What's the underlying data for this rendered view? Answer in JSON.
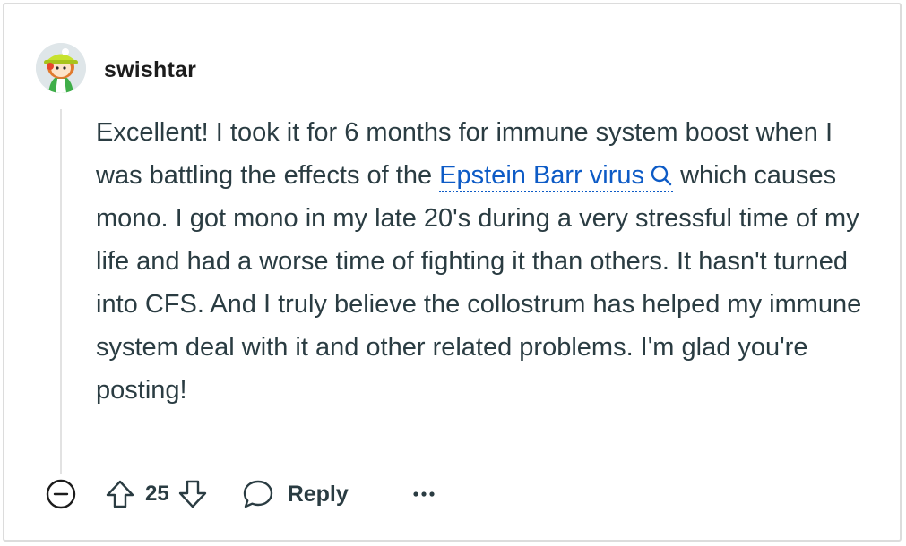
{
  "comment": {
    "author": "swishtar",
    "body_start": "Excellent! I took it for 6 months for immune system boost when I was battling the effects of the ",
    "link_text": "Epstein Barr virus",
    "body_end": " which causes mono. I got mono in my late 20's during a very stressful time of my life and had a worse time of fighting it than others. It hasn't turned into CFS. And I truly believe the collostrum has helped my immune system deal with it and other related problems. I'm glad you're posting!"
  },
  "actions": {
    "score": "25",
    "reply_label": "Reply"
  },
  "icons": {
    "collapse": "minus-circle-icon",
    "upvote": "upvote-arrow-icon",
    "downvote": "downvote-arrow-icon",
    "reply": "speech-bubble-icon",
    "more": "ellipsis-icon",
    "link_search": "search-icon"
  },
  "colors": {
    "link": "#0d5bc6",
    "text": "#2a3c42",
    "username": "#1c1c1c"
  }
}
